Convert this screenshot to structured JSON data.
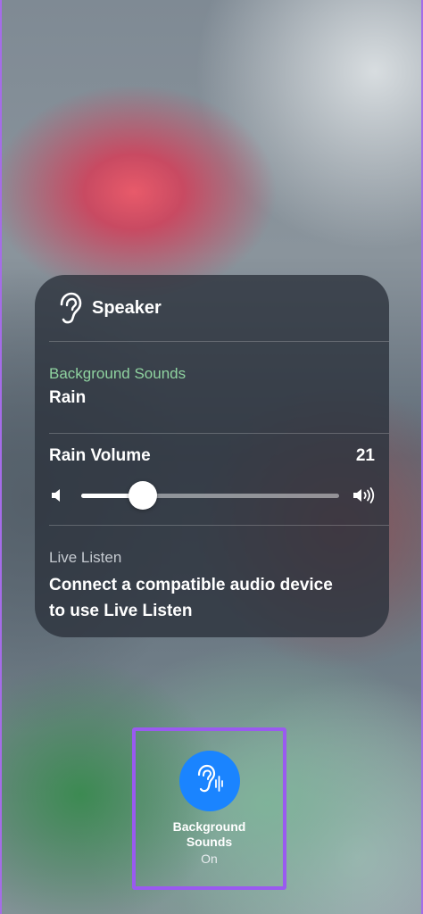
{
  "panel": {
    "header_title": "Speaker",
    "background_sounds": {
      "label": "Background Sounds",
      "value": "Rain"
    },
    "volume": {
      "label": "Rain Volume",
      "value": "21",
      "slider_fraction": 0.24
    },
    "live_listen": {
      "label": "Live Listen",
      "text_line1": "Connect a compatible audio device",
      "text_line2": "to use Live Listen"
    }
  },
  "toggle": {
    "title_line1": "Background",
    "title_line2": "Sounds",
    "status": "On",
    "accent_color": "#1a84ff",
    "highlight_color": "#9a5af0"
  },
  "icons": {
    "header": "ear-icon",
    "volume_low": "speaker-low-icon",
    "volume_high": "speaker-high-icon",
    "toggle": "ear-waveform-icon"
  },
  "colors": {
    "sub_label_green": "#8fd3a0",
    "panel_bg": "#2c323c"
  }
}
